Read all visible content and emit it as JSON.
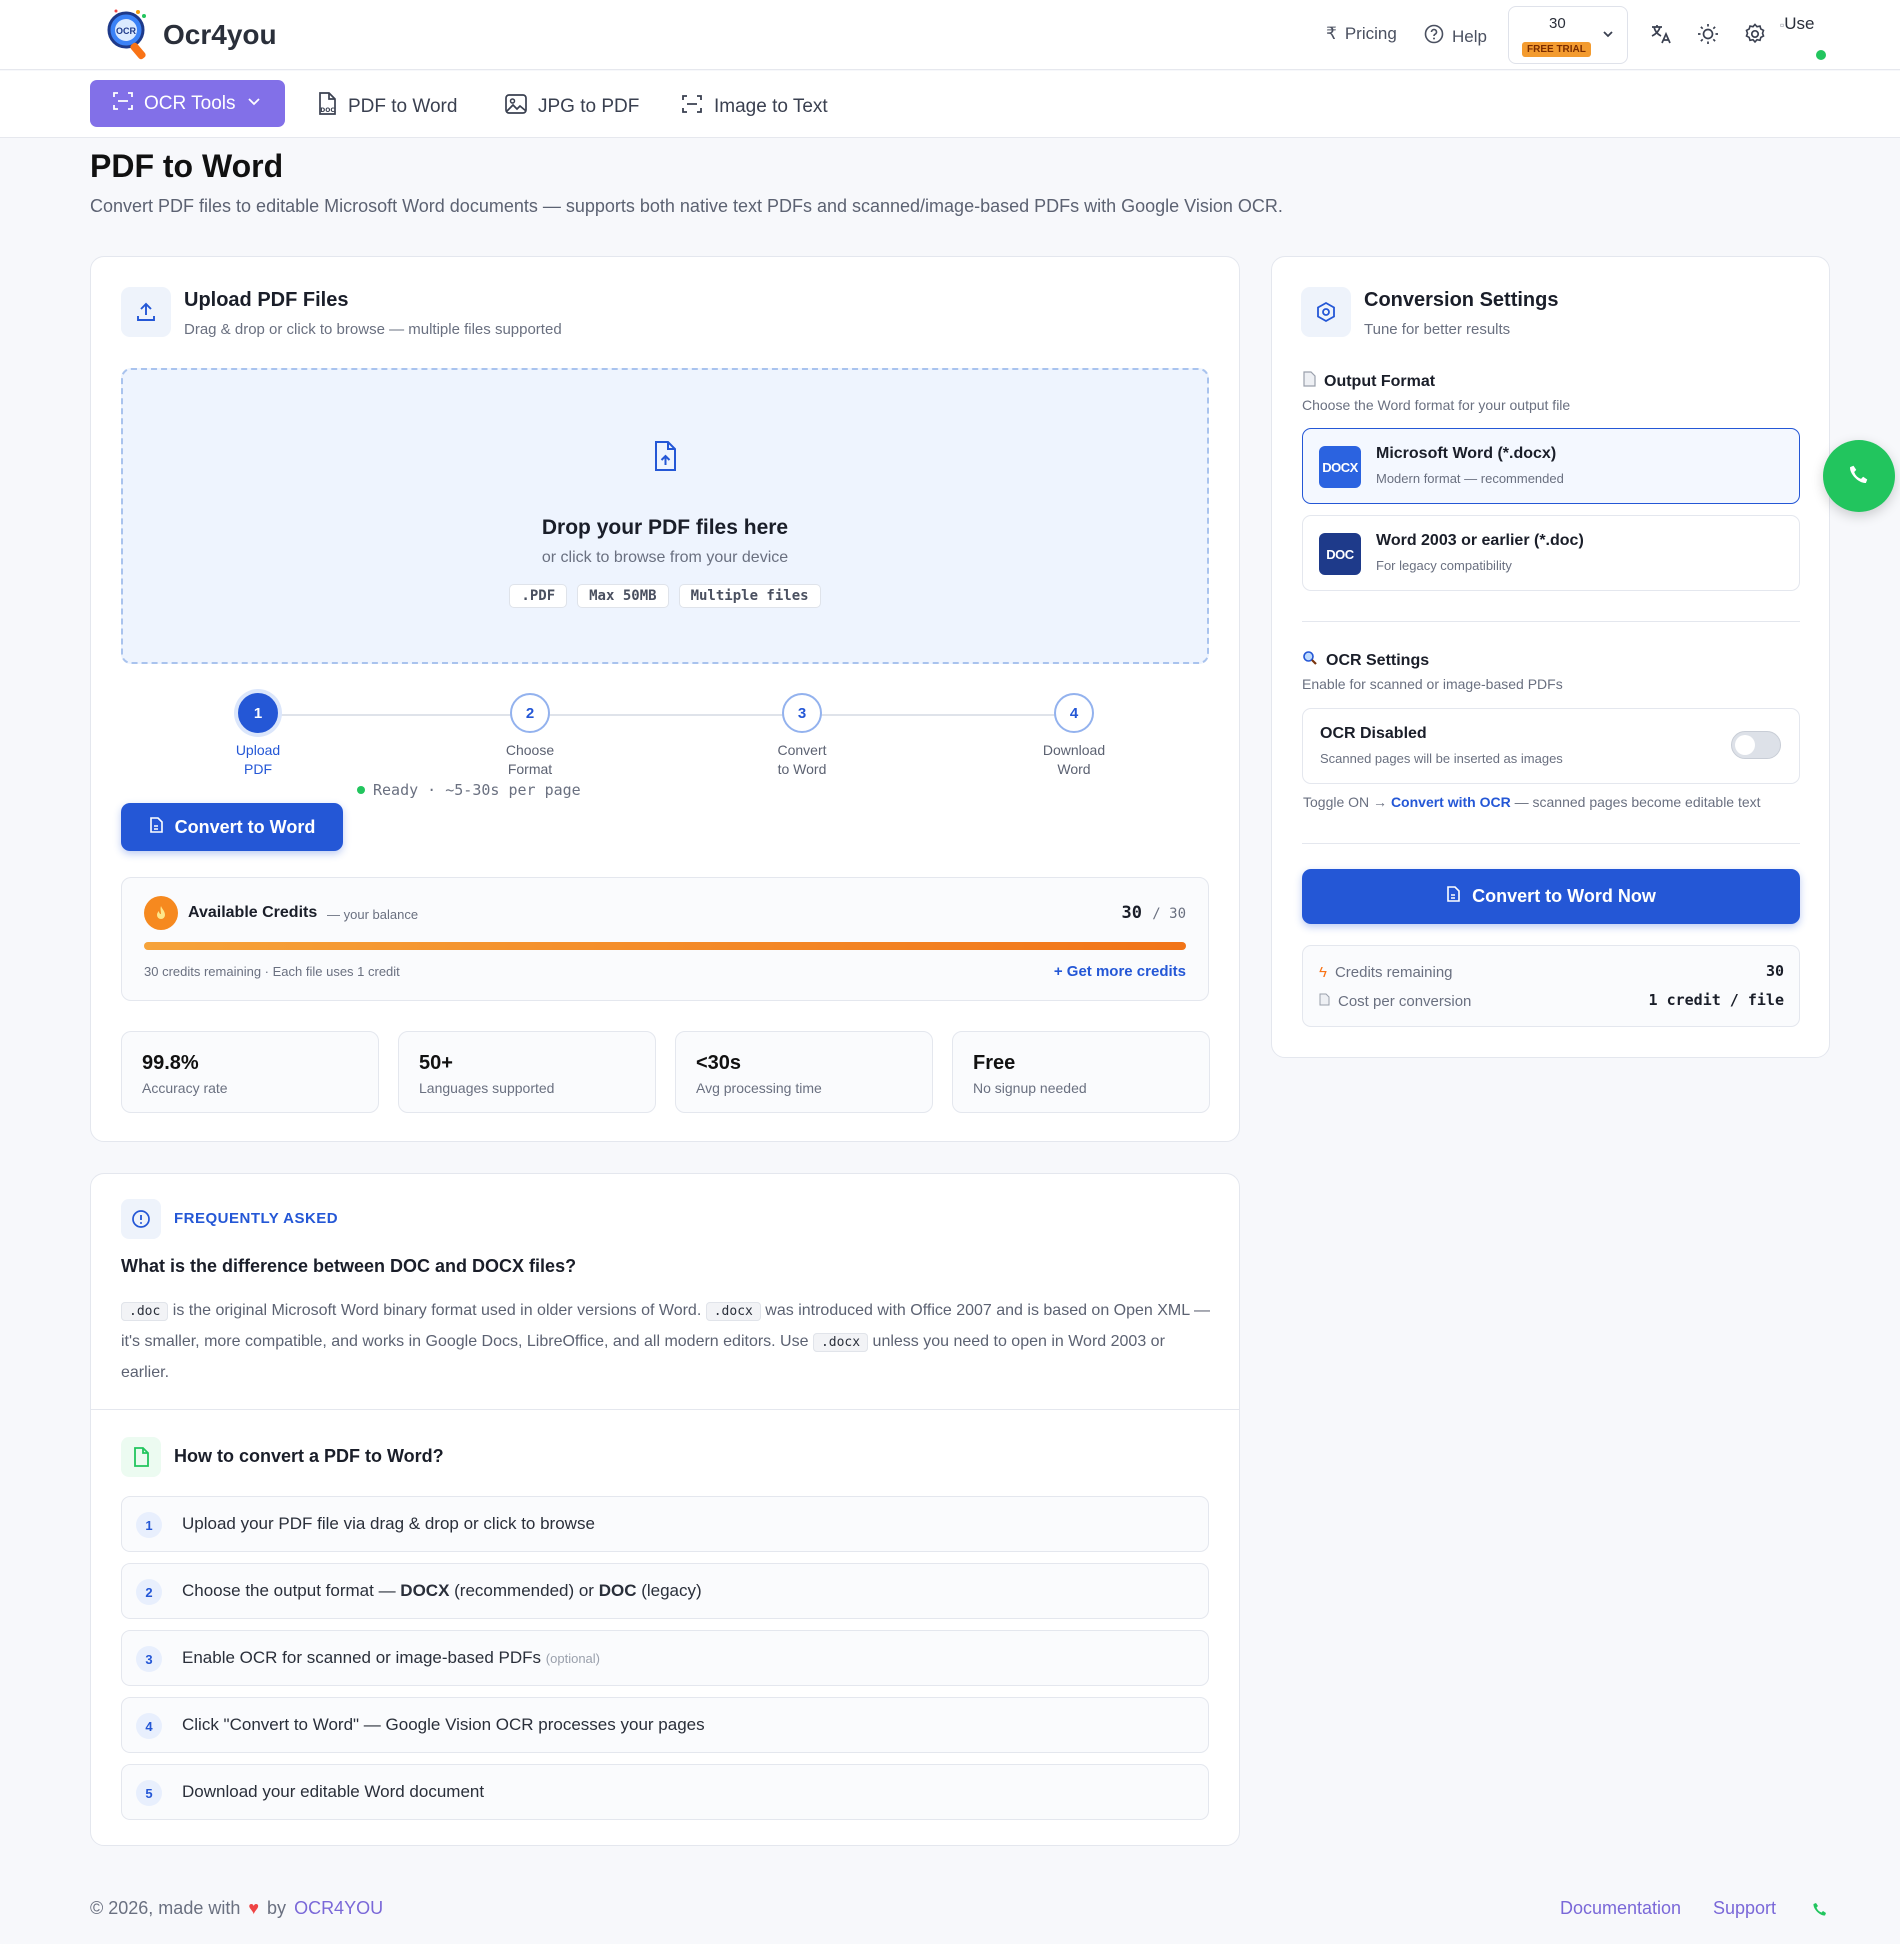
{
  "header": {
    "brand": "Ocr4you",
    "logo_text": "OCR",
    "pricing": "Pricing",
    "help": "Help",
    "credits": "30",
    "credits_badge": "FREE TRIAL",
    "avatar_alt": "Use"
  },
  "nav": {
    "primary": "OCR Tools",
    "items": [
      "PDF to Word",
      "JPG to PDF",
      "Image to Text"
    ]
  },
  "page": {
    "title": "PDF to Word",
    "subtitle": "Convert PDF files to editable Microsoft Word documents — supports both native text PDFs and scanned/image-based PDFs with Google Vision OCR."
  },
  "upload": {
    "title": "Upload PDF Files",
    "subtitle": "Drag & drop or click to browse — multiple files supported",
    "drop_title": "Drop your PDF files here",
    "drop_sub": "or click to browse from your device",
    "chips": [
      ".PDF",
      "Max 50MB",
      "Multiple files"
    ],
    "steps": [
      {
        "num": "1",
        "line1": "Upload",
        "line2": "PDF"
      },
      {
        "num": "2",
        "line1": "Choose",
        "line2": "Format"
      },
      {
        "num": "3",
        "line1": "Convert",
        "line2": "to Word"
      },
      {
        "num": "4",
        "line1": "Download",
        "line2": "Word"
      }
    ],
    "convert_button": "Convert to Word",
    "status": "Ready · ~5-30s per page"
  },
  "credits_box": {
    "title": "Available Credits",
    "subtitle": "— your balance",
    "current": "30",
    "total": "/ 30",
    "fill_fraction": 1.0,
    "note": "30 credits remaining · Each file uses 1 credit",
    "more": "+ Get more credits"
  },
  "stats": [
    {
      "value": "99.8%",
      "label": "Accuracy rate"
    },
    {
      "value": "50+",
      "label": "Languages supported"
    },
    {
      "value": "<30s",
      "label": "Avg processing time"
    },
    {
      "value": "Free",
      "label": "No signup needed"
    }
  ],
  "settings": {
    "title": "Conversion Settings",
    "subtitle": "Tune for better results",
    "output_label": "Output Format",
    "output_sub": "Choose the Word format for your output file",
    "formats": [
      {
        "badge": "DOCX",
        "title": "Microsoft Word (*.docx)",
        "sub": "Modern format — recommended",
        "color": "#2b63e0"
      },
      {
        "badge": "DOC",
        "title": "Word 2003 or earlier (*.doc)",
        "sub": "For legacy compatibility",
        "color": "#1e3a8a"
      }
    ],
    "ocr_label": "OCR Settings",
    "ocr_sub": "Enable for scanned or image-based PDFs",
    "ocr_title": "OCR Disabled",
    "ocr_desc": "Scanned pages will be inserted as images",
    "hint_pre": "Toggle ON →",
    "hint_link": "Convert with OCR",
    "hint_post": "— scanned pages become editable text",
    "convert_now": "Convert to Word Now",
    "summary": [
      {
        "label": "Credits remaining",
        "value": "30"
      },
      {
        "label": "Cost per conversion",
        "value": "1 credit / file"
      }
    ]
  },
  "faq": {
    "label": "FREQUENTLY ASKED",
    "question": "What is the difference between DOC and DOCX files?",
    "answer": {
      "code1": ".doc",
      "t1": " is the original Microsoft Word binary format used in older versions of Word. ",
      "code2": ".docx",
      "t2": " was introduced with Office 2007 and is based on Open XML — it's smaller, more compatible, and works in Google Docs, LibreOffice, and all modern editors. Use ",
      "code3": ".docx",
      "t3": " unless you need to open in Word 2003 or earlier."
    },
    "how_title": "How to convert a PDF to Word?",
    "how_steps": [
      {
        "num": "1",
        "text": "Upload your PDF file via drag & drop or click to browse"
      },
      {
        "num": "2",
        "pre": "Choose the output format — ",
        "b1": "DOCX",
        "mid": " (recommended) or ",
        "b2": "DOC",
        "post": " (legacy)"
      },
      {
        "num": "3",
        "text": "Enable OCR for scanned or image-based PDFs",
        "small": "(optional)"
      },
      {
        "num": "4",
        "text": "Click \"Convert to Word\" — Google Vision OCR processes your pages"
      },
      {
        "num": "5",
        "text": "Download your editable Word document"
      }
    ]
  },
  "footer": {
    "pre": "© 2026, made with",
    "by": "by",
    "brand": "OCR4YOU",
    "docs": "Documentation",
    "support": "Support"
  },
  "colors": {
    "accent": "#2457d6",
    "nav_primary": "#8270e8",
    "success": "#22c55e",
    "credit_bar": "#f39b2f"
  }
}
